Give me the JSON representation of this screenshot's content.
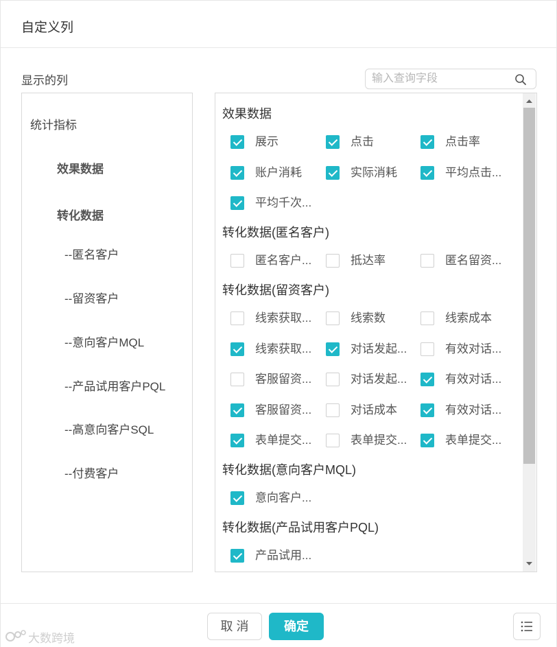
{
  "dialog": {
    "title": "自定义列"
  },
  "display_columns_label": "显示的列",
  "search": {
    "placeholder": "输入查询字段",
    "value": ""
  },
  "nav": {
    "items": [
      {
        "label": "统计指标",
        "bold": false
      },
      {
        "label": "效果数据",
        "bold": true
      },
      {
        "label": "转化数据",
        "bold": true
      },
      {
        "label": "--匿名客户",
        "bold": false
      },
      {
        "label": "--留资客户",
        "bold": false
      },
      {
        "label": "--意向客户MQL",
        "bold": false
      },
      {
        "label": "--产品试用客户PQL",
        "bold": false
      },
      {
        "label": "--高意向客户SQL",
        "bold": false
      },
      {
        "label": "--付费客户",
        "bold": false
      }
    ]
  },
  "groups": [
    {
      "title": "效果数据",
      "fields": [
        {
          "label": "展示",
          "checked": true
        },
        {
          "label": "点击",
          "checked": true
        },
        {
          "label": "点击率",
          "checked": true
        },
        {
          "label": "账户消耗",
          "checked": true
        },
        {
          "label": "实际消耗",
          "checked": true
        },
        {
          "label": "平均点击...",
          "checked": true
        },
        {
          "label": "平均千次...",
          "checked": true
        }
      ]
    },
    {
      "title": "转化数据(匿名客户)",
      "fields": [
        {
          "label": "匿名客户...",
          "checked": false
        },
        {
          "label": "抵达率",
          "checked": false
        },
        {
          "label": "匿名留资...",
          "checked": false
        }
      ]
    },
    {
      "title": "转化数据(留资客户)",
      "fields": [
        {
          "label": "线索获取...",
          "checked": false
        },
        {
          "label": "线索数",
          "checked": false
        },
        {
          "label": "线索成本",
          "checked": false
        },
        {
          "label": "线索获取...",
          "checked": true
        },
        {
          "label": "对话发起...",
          "checked": true
        },
        {
          "label": "有效对话...",
          "checked": false
        },
        {
          "label": "客服留资...",
          "checked": false
        },
        {
          "label": "对话发起...",
          "checked": false
        },
        {
          "label": "有效对话...",
          "checked": true
        },
        {
          "label": "客服留资...",
          "checked": true
        },
        {
          "label": "对话成本",
          "checked": false
        },
        {
          "label": "有效对话...",
          "checked": true
        },
        {
          "label": "表单提交...",
          "checked": true
        },
        {
          "label": "表单提交...",
          "checked": false
        },
        {
          "label": "表单提交...",
          "checked": true
        }
      ]
    },
    {
      "title": "转化数据(意向客户MQL)",
      "fields": [
        {
          "label": "意向客户...",
          "checked": true
        }
      ]
    },
    {
      "title": "转化数据(产品试用客户PQL)",
      "fields": [
        {
          "label": "产品试用...",
          "checked": true
        }
      ]
    }
  ],
  "footer": {
    "cancel_label": "取 消",
    "ok_label": "确定"
  },
  "watermark": {
    "text": "大数跨境"
  },
  "colors": {
    "accent": "#1fb8c8",
    "border": "#d9d9d9",
    "scroll_thumb": "#c1c1c1"
  }
}
